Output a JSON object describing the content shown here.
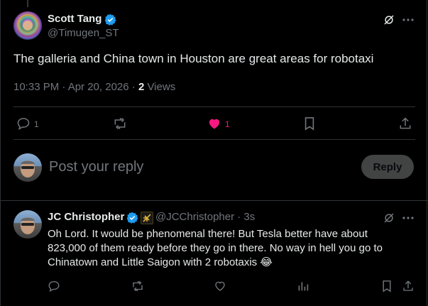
{
  "post": {
    "author_name": "Scott Tang",
    "author_handle": "@Timugen_ST",
    "text": "The galleria and China town in Houston are great areas for robotaxi",
    "timestamp": "10:33 PM · Apr 20, 2026 · ",
    "views_count": "2",
    "views_label": " Views",
    "reply_count": "1",
    "like_count": "1"
  },
  "composer": {
    "placeholder": "Post your reply",
    "reply_button": "Reply"
  },
  "reply": {
    "author_name": "JC Christopher",
    "author_handle": "@JCChristopher",
    "time": " · 3s",
    "lines": [
      "Oh Lord. It would be phenomenal there! But Tesla better have about",
      "823,000 of them ready before they go in there. No way in hell you go to",
      "Chinatown and Little Saigon with 2 robotaxis"
    ],
    "emoji": "😂"
  },
  "colors": {
    "accent": "#1d9bf0",
    "like": "#f91880",
    "muted": "#71767b",
    "divider": "#2f3336"
  }
}
